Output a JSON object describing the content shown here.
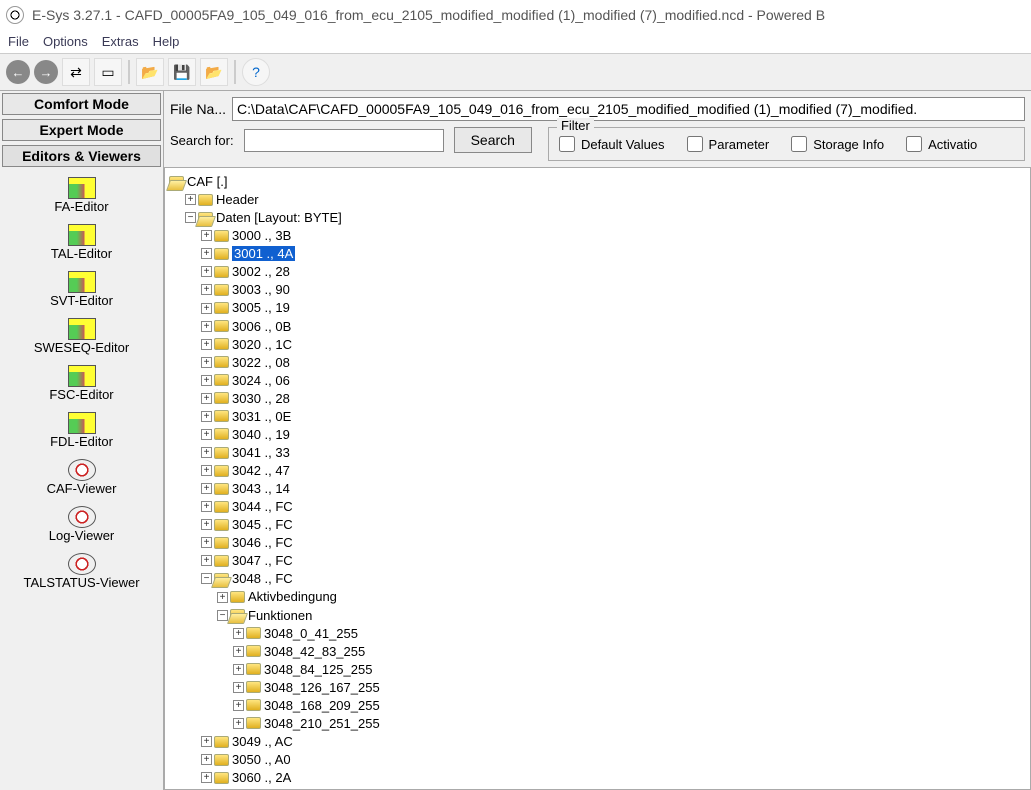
{
  "window": {
    "title": "E-Sys 3.27.1 - CAFD_00005FA9_105_049_016_from_ecu_2105_modified_modified (1)_modified (7)_modified.ncd   - Powered B"
  },
  "menu": {
    "items": [
      "File",
      "Options",
      "Extras",
      "Help"
    ]
  },
  "sidebar": {
    "modes": [
      "Comfort Mode",
      "Expert Mode",
      "Editors & Viewers"
    ],
    "editors": [
      "FA-Editor",
      "TAL-Editor",
      "SVT-Editor",
      "SWESEQ-Editor",
      "FSC-Editor",
      "FDL-Editor",
      "CAF-Viewer",
      "Log-Viewer",
      "TALSTATUS-Viewer"
    ]
  },
  "file": {
    "label": "File Na...",
    "path": "C:\\Data\\CAF\\CAFD_00005FA9_105_049_016_from_ecu_2105_modified_modified (1)_modified (7)_modified."
  },
  "search": {
    "label": "Search for:",
    "value": "",
    "button": "Search"
  },
  "filter": {
    "legend": "Filter",
    "checks": [
      "Default Values",
      "Parameter",
      "Storage Info",
      "Activatio"
    ]
  },
  "tree": {
    "root": "CAF [.]",
    "header": "Header",
    "daten": "Daten [Layout: BYTE]",
    "items": [
      {
        "t": "3000 ., 3B"
      },
      {
        "t": "3001 ., 4A",
        "sel": true
      },
      {
        "t": "3002 ., 28"
      },
      {
        "t": "3003 ., 90"
      },
      {
        "t": "3005 ., 19"
      },
      {
        "t": "3006 ., 0B"
      },
      {
        "t": "3020 ., 1C"
      },
      {
        "t": "3022 ., 08"
      },
      {
        "t": "3024 ., 06"
      },
      {
        "t": "3030 ., 28"
      },
      {
        "t": "3031 ., 0E"
      },
      {
        "t": "3040 ., 19"
      },
      {
        "t": "3041 ., 33"
      },
      {
        "t": "3042 ., 47"
      },
      {
        "t": "3043 ., 14"
      },
      {
        "t": "3044 ., FC"
      },
      {
        "t": "3045 ., FC"
      },
      {
        "t": "3046 ., FC"
      },
      {
        "t": "3047 ., FC"
      }
    ],
    "n3048": {
      "label": "3048 ., FC",
      "aktiv": "Aktivbedingung",
      "funk": "Funktionen",
      "funcs": [
        "3048_0_41_255",
        "3048_42_83_255",
        "3048_84_125_255",
        "3048_126_167_255",
        "3048_168_209_255",
        "3048_210_251_255"
      ]
    },
    "after": [
      {
        "t": "3049 ., AC"
      },
      {
        "t": "3050 ., A0"
      },
      {
        "t": "3060 ., 2A"
      }
    ]
  }
}
